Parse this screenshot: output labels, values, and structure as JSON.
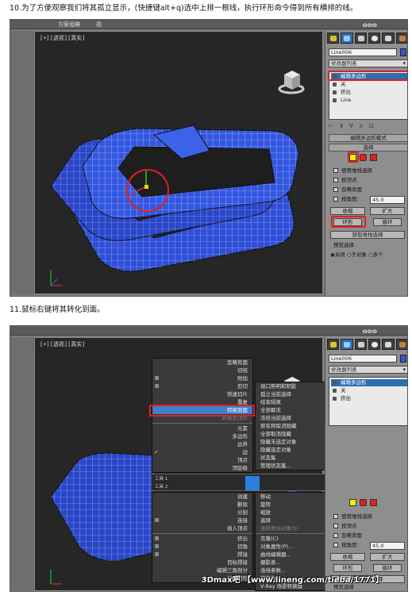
{
  "step10": {
    "caption": "10.为了方便观察我们将其孤立显示，(快捷键alt+q)选中上排一根线，执行环形命令得到所有横排的线。",
    "topbar": [
      "方案组稿",
      "视"
    ],
    "viewport_label": "[+][透视][真实]",
    "object_name": "Line006",
    "modifier_list": "修改器列表",
    "stack": [
      "编辑多边形",
      "关",
      "挤出",
      "Line"
    ],
    "rollout_edit_poly": "编辑多边形模式",
    "rollout_select": "选择",
    "options": [
      "使用堆栈选择",
      "按顶点",
      "忽略背面",
      "按角度:"
    ],
    "angle_value": "45.0",
    "btn_shrink": "收缩",
    "btn_grow": "扩大",
    "btn_ring": "环形",
    "btn_loop": "循环",
    "btn_get_stack": "获取堆栈选择",
    "preview_label": "预览选择",
    "preview_options": [
      "关闭",
      "子对象",
      "多个"
    ]
  },
  "step11": {
    "caption": "11.鼠标右键将其转化到面。",
    "object_name": "Line006",
    "modifier_list": "修改器列表",
    "stack": [
      "编辑多边形",
      "关",
      "挤出"
    ],
    "options": [
      "使用堆栈选择",
      "按顶点",
      "忽略背面",
      "按角度:"
    ],
    "angle_value": "45.0",
    "btn_shrink": "收缩",
    "btn_grow": "扩大",
    "btn_ring": "环形",
    "btn_loop": "循环",
    "btn_get_stack": "获取堆栈选择",
    "preview_label": "预览选择",
    "menu_left_top": [
      "忽略背面",
      "切结",
      "附加",
      "剪切",
      "快速切片",
      "重复",
      "转换到面",
      "转换到顶点",
      "元素",
      "多边形",
      "边界",
      "边",
      "顶点",
      "顶层级"
    ],
    "menu_right_top": [
      "视口照明和阴影",
      "孤立当前选择",
      "结束隔离",
      "全部解冻",
      "冻结当前选择",
      "按名称取消隐藏",
      "全部取消隐藏",
      "隐藏未选定对象",
      "隐藏选定对象",
      "状态集",
      "管理状态集..."
    ],
    "quad_labels": [
      "工具 1",
      "工具 2",
      "显示",
      "变换"
    ],
    "menu_left_bottom": [
      "创建",
      "删除",
      "分割",
      "连接",
      "插入顶点",
      "挤出",
      "切角",
      "焊接",
      "目标焊接",
      "编辑三角剖分",
      "创建图形"
    ],
    "menu_right_bottom": [
      "移动",
      "旋转",
      "缩放",
      "选择",
      "选择类似对象(S)",
      "克隆(C)",
      "对象属性(P)...",
      "曲线编辑器...",
      "摄影表...",
      "连线参数...",
      "转换为:",
      "V-Ray 场景转换器"
    ],
    "watermark": "3Dmax吧 【www.lineng.com/tieba/1771】"
  },
  "colors": {
    "highlight_red": "#e02020",
    "selection_blue": "#2f6db0",
    "object_blue": "#2f4fd8"
  }
}
